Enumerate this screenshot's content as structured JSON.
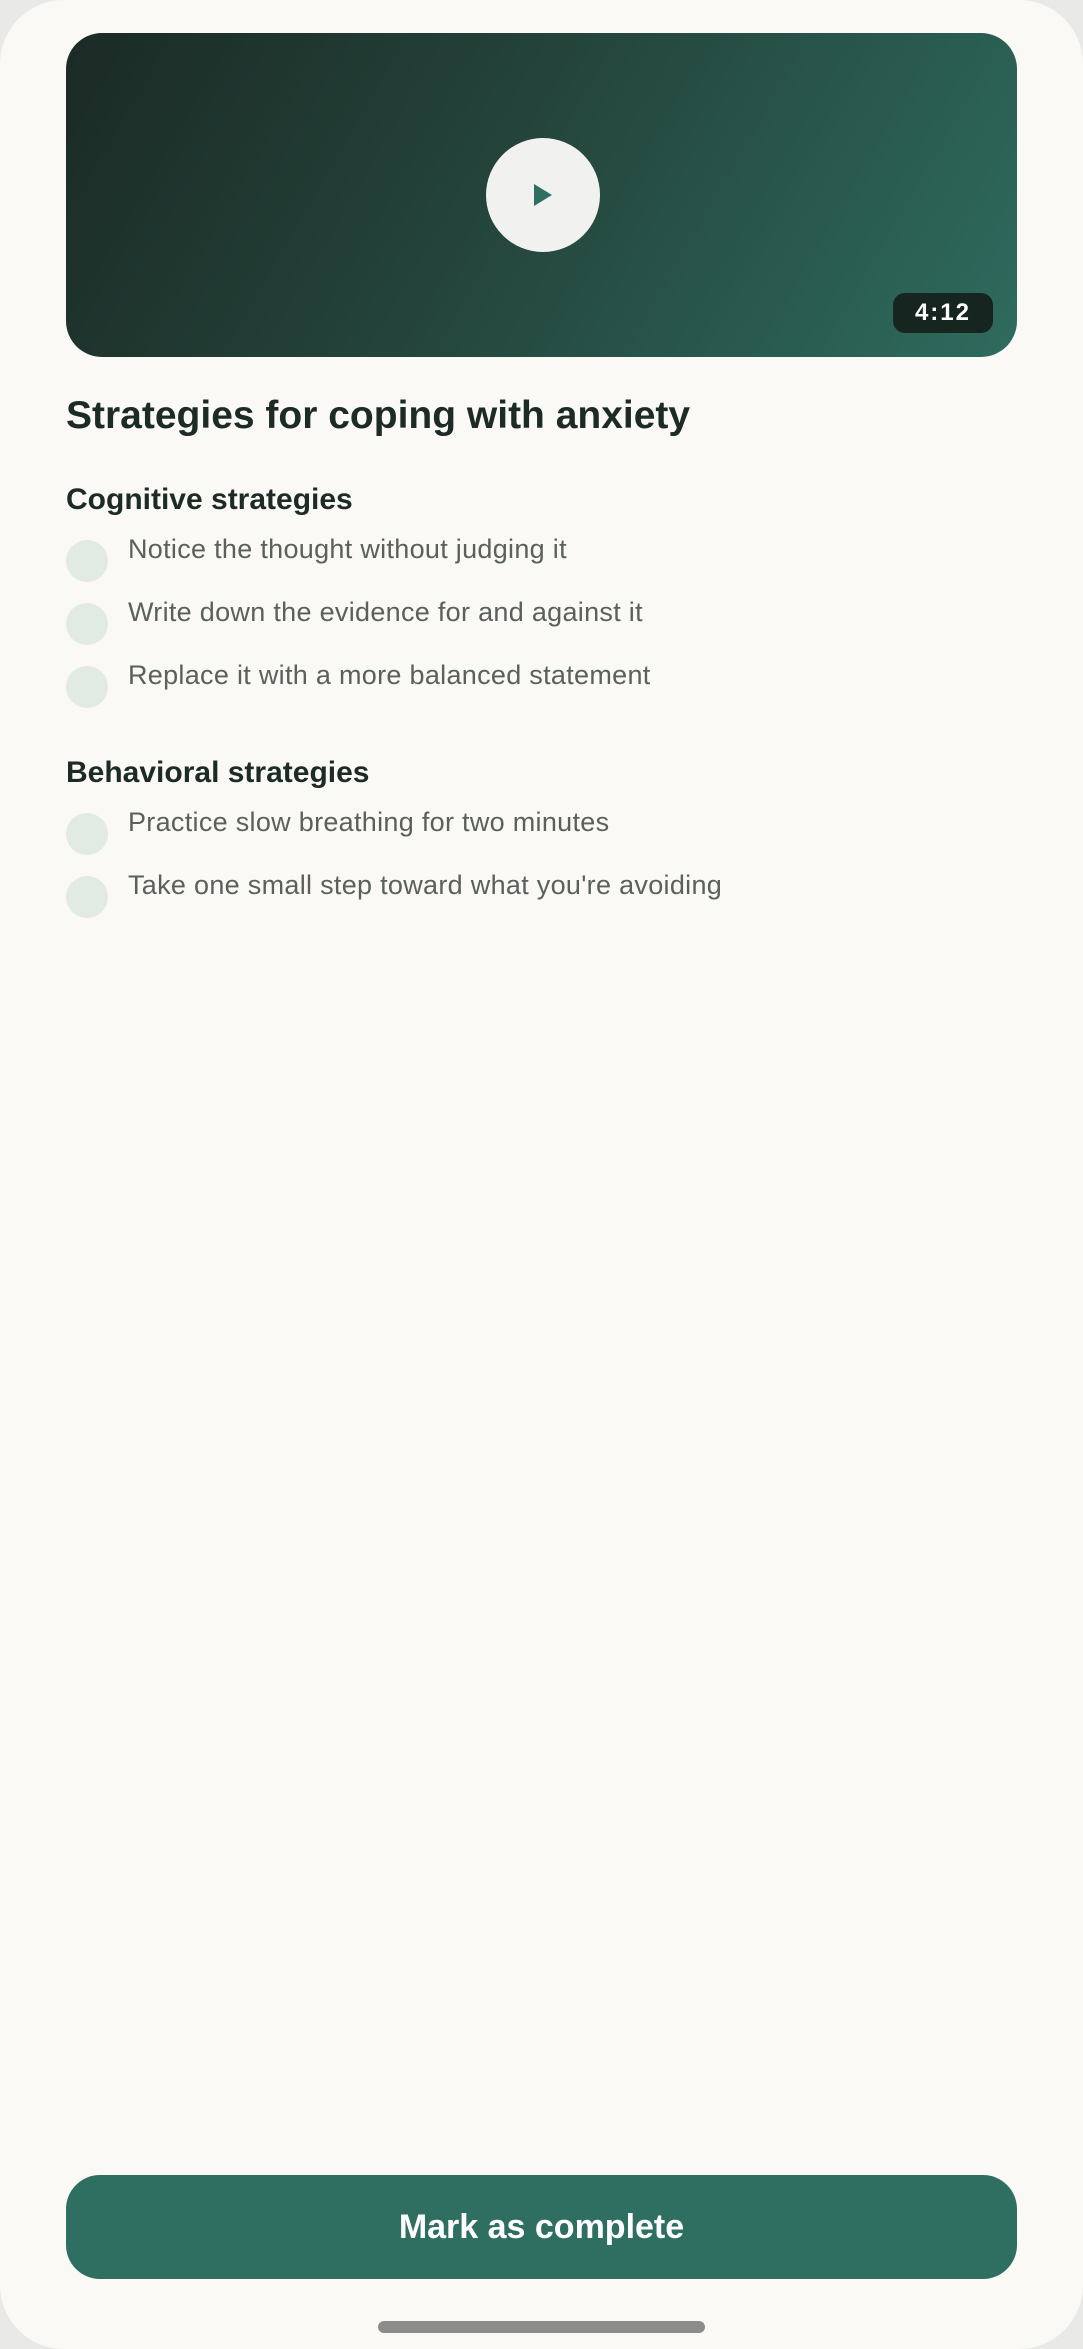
{
  "video": {
    "duration": "4:12",
    "play_icon": "play-icon",
    "colors": {
      "gradient_start": "#1b2a25",
      "gradient_end": "#2e6b5e"
    }
  },
  "lesson": {
    "title": "Strategies for coping with anxiety",
    "sections": [
      {
        "title": "Cognitive strategies",
        "items": [
          "Notice the thought without judging it",
          "Write down the evidence for and against it",
          "Replace it with a more balanced statement"
        ]
      },
      {
        "title": "Behavioral strategies",
        "items": [
          "Practice slow breathing for two minutes",
          "Take one small step toward what you're avoiding"
        ]
      }
    ]
  },
  "actions": {
    "complete_label": "Mark as complete"
  },
  "colors": {
    "accent": "#2f6f62",
    "checkbox": "#e1ebe2",
    "text_primary": "#1d2b26",
    "text_secondary": "#5a605c",
    "background": "#faf9f5"
  }
}
